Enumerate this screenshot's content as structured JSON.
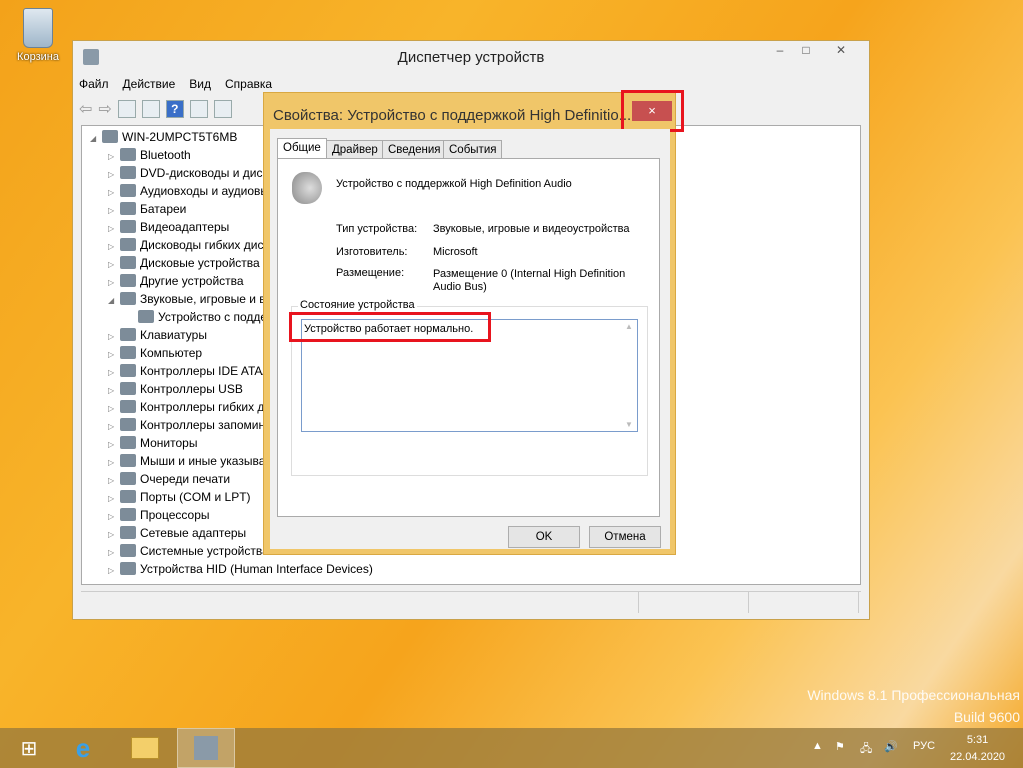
{
  "desktop": {
    "recycle_bin": "Корзина",
    "watermark_line1": "Windows 8.1 Профессиональная",
    "watermark_line2": "Build 9600"
  },
  "main_window": {
    "title": "Диспетчер устройств",
    "menu": [
      "Файл",
      "Действие",
      "Вид",
      "Справка"
    ],
    "tree": {
      "root": "WIN-2UMPCT5T6MB",
      "items": [
        {
          "label": "Bluetooth",
          "icon": "bluetooth-icon"
        },
        {
          "label": "DVD-дисководы и дисководы компакт-дисков",
          "icon": "dvd-icon"
        },
        {
          "label": "Аудиовходы и аудиовыходы",
          "icon": "speaker-icon"
        },
        {
          "label": "Батареи",
          "icon": "battery-icon"
        },
        {
          "label": "Видеоадаптеры",
          "icon": "display-adapter-icon"
        },
        {
          "label": "Дисководы гибких дисков",
          "icon": "floppy-icon"
        },
        {
          "label": "Дисковые устройства",
          "icon": "disk-icon"
        },
        {
          "label": "Другие устройства",
          "icon": "unknown-device-icon"
        },
        {
          "label": "Звуковые, игровые и видеоустройства",
          "icon": "speaker-icon",
          "expanded": true,
          "children": [
            {
              "label": "Устройство с поддержкой High Definition Audio"
            }
          ]
        },
        {
          "label": "Клавиатуры",
          "icon": "keyboard-icon"
        },
        {
          "label": "Компьютер",
          "icon": "computer-icon"
        },
        {
          "label": "Контроллеры IDE ATA/ATAPI",
          "icon": "ide-icon"
        },
        {
          "label": "Контроллеры USB",
          "icon": "usb-icon"
        },
        {
          "label": "Контроллеры гибких дисков",
          "icon": "floppy-controller-icon"
        },
        {
          "label": "Контроллеры запоминающих устройств",
          "icon": "storage-icon"
        },
        {
          "label": "Мониторы",
          "icon": "monitor-icon"
        },
        {
          "label": "Мыши и иные указывающие устройства",
          "icon": "mouse-icon"
        },
        {
          "label": "Очереди печати",
          "icon": "printer-icon"
        },
        {
          "label": "Порты (COM и LPT)",
          "icon": "port-icon"
        },
        {
          "label": "Процессоры",
          "icon": "cpu-icon"
        },
        {
          "label": "Сетевые адаптеры",
          "icon": "network-icon"
        },
        {
          "label": "Системные устройства",
          "icon": "system-icon"
        },
        {
          "label": "Устройства HID (Human Interface Devices)",
          "icon": "hid-icon"
        }
      ]
    }
  },
  "dialog": {
    "title": "Свойства: Устройство с поддержкой High Definitio...",
    "tabs": [
      "Общие",
      "Драйвер",
      "Сведения",
      "События"
    ],
    "device_name": "Устройство с поддержкой High Definition Audio",
    "fields": [
      {
        "label": "Тип устройства:",
        "value": "Звуковые, игровые и видеоустройства"
      },
      {
        "label": "Изготовитель:",
        "value": "Microsoft"
      },
      {
        "label": "Размещение:",
        "value": "Размещение 0 (Internal High Definition Audio Bus)"
      }
    ],
    "status_group": "Состояние устройства",
    "status_text": "Устройство работает нормально.",
    "ok": "OK",
    "cancel": "Отмена",
    "close": "×"
  },
  "taskbar": {
    "lang": "РУС",
    "time": "5:31",
    "date": "22.04.2020"
  },
  "colors": {
    "dialog_frame": "#f0c669",
    "close_button": "#c75050",
    "highlight": "#e8141e"
  }
}
